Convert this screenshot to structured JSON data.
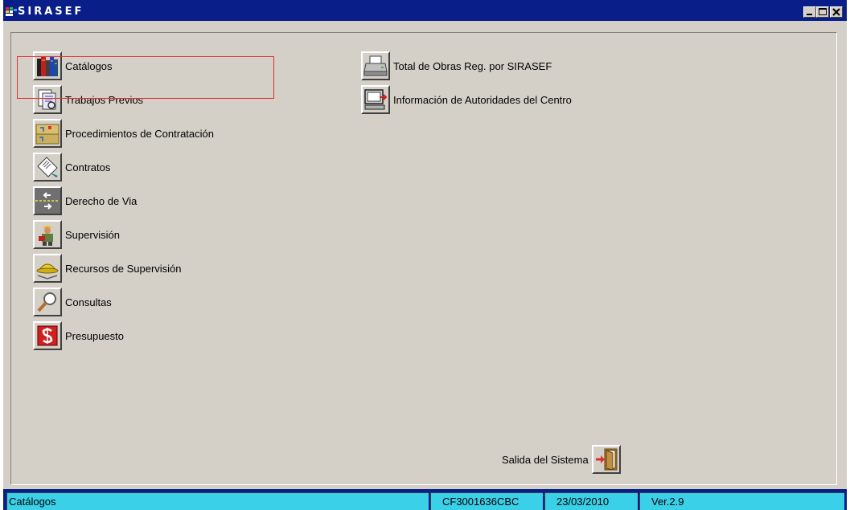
{
  "window": {
    "title": "SIRASEF"
  },
  "menu_left": [
    {
      "label": "Catálogos",
      "icon": "books-icon"
    },
    {
      "label": "Trabajos Previos",
      "icon": "documents-icon"
    },
    {
      "label": "Procedimientos de Contratación",
      "icon": "folders-icon"
    },
    {
      "label": "Contratos",
      "icon": "contract-pen-icon"
    },
    {
      "label": "Derecho de Via",
      "icon": "road-arrows-icon"
    },
    {
      "label": "Supervisión",
      "icon": "worker-icon"
    },
    {
      "label": "Recursos de Supervisión",
      "icon": "hardhat-icon"
    },
    {
      "label": "Consultas",
      "icon": "magnifier-icon"
    },
    {
      "label": "Presupuesto",
      "icon": "money-icon"
    }
  ],
  "menu_right": [
    {
      "label": "Total de Obras Reg. por SIRASEF",
      "icon": "printer-icon"
    },
    {
      "label": "Información de Autoridades del Centro",
      "icon": "computer-icon"
    }
  ],
  "exit": {
    "label": "Salida del Sistema",
    "icon": "exit-door-icon"
  },
  "status": {
    "current": "Catálogos",
    "code": "CF3001636CBC",
    "date": "23/03/2010",
    "version": "Ver.2.9"
  },
  "colors": {
    "titlebar": "#0a1e8a",
    "face": "#d4d0c8",
    "status_field": "#3ad0e8",
    "selection_border": "#e03030"
  }
}
